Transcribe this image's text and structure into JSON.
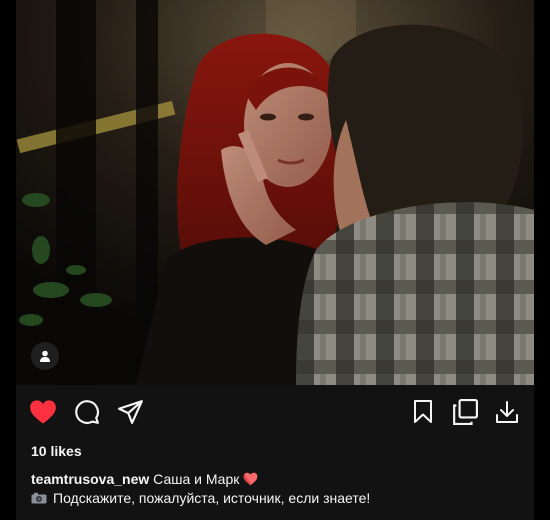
{
  "post": {
    "photo_alt": "",
    "tag_icon": "user-icon",
    "actions": {
      "like_icon": "heart-filled-icon",
      "like_color": "#ff3040",
      "comment_icon": "comment-icon",
      "share_icon": "paper-plane-icon",
      "save_icon": "bookmark-icon",
      "collection_icon": "copy-icon",
      "download_icon": "download-icon"
    },
    "likes_text": "10 likes",
    "caption": {
      "username": "teamtrusova_new",
      "text": "Саша и Марк",
      "heart_emoji": "heart-emoji",
      "line2_emoji": "camera-emoji",
      "line2": "Подскажите, пожалуйста, источник, если знаете!"
    }
  }
}
